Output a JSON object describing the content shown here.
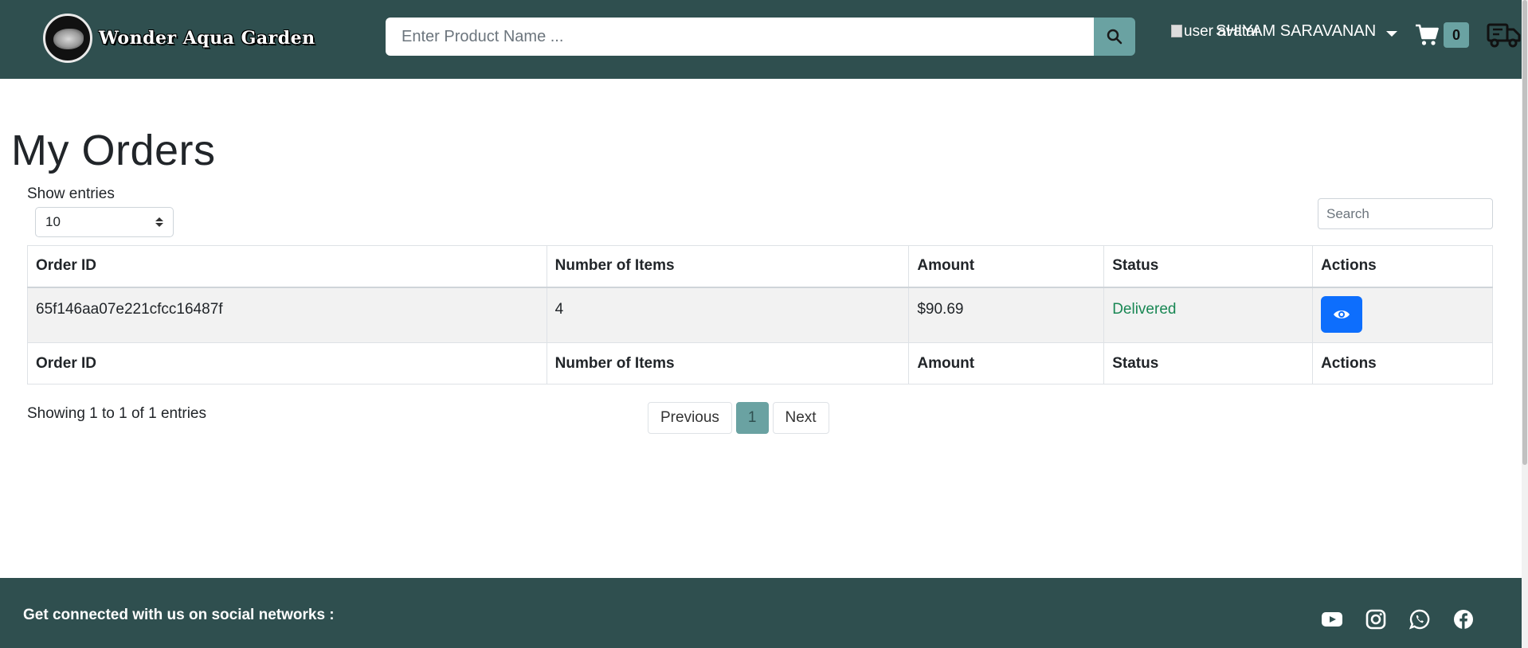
{
  "header": {
    "brand_name": "Wonder Aqua Garden",
    "search_placeholder": "Enter Product Name ...",
    "avatar_alt": "user avatar",
    "user_name": "SHIYAM SARAVANAN",
    "cart_count": "0"
  },
  "main": {
    "title": "My Orders",
    "show_entries_label": "Show entries",
    "entries_value": "10",
    "search_placeholder": "Search",
    "columns": [
      "Order ID",
      "Number of Items",
      "Amount",
      "Status",
      "Actions"
    ],
    "rows": [
      {
        "order_id": "65f146aa07e221cfcc16487f",
        "items": "4",
        "amount": "$90.69",
        "status": "Delivered"
      }
    ],
    "showing_text": "Showing 1 to 1 of 1 entries",
    "pagination": {
      "previous": "Previous",
      "current": "1",
      "next": "Next"
    }
  },
  "footer": {
    "text": "Get connected with us on social networks :",
    "socials": [
      "youtube-icon",
      "instagram-icon",
      "whatsapp-icon",
      "facebook-icon"
    ]
  },
  "colors": {
    "navbar": "#2f4f4f",
    "accent": "#6aa2a2",
    "primary_button": "#0d6efd",
    "status_delivered": "#198754"
  }
}
